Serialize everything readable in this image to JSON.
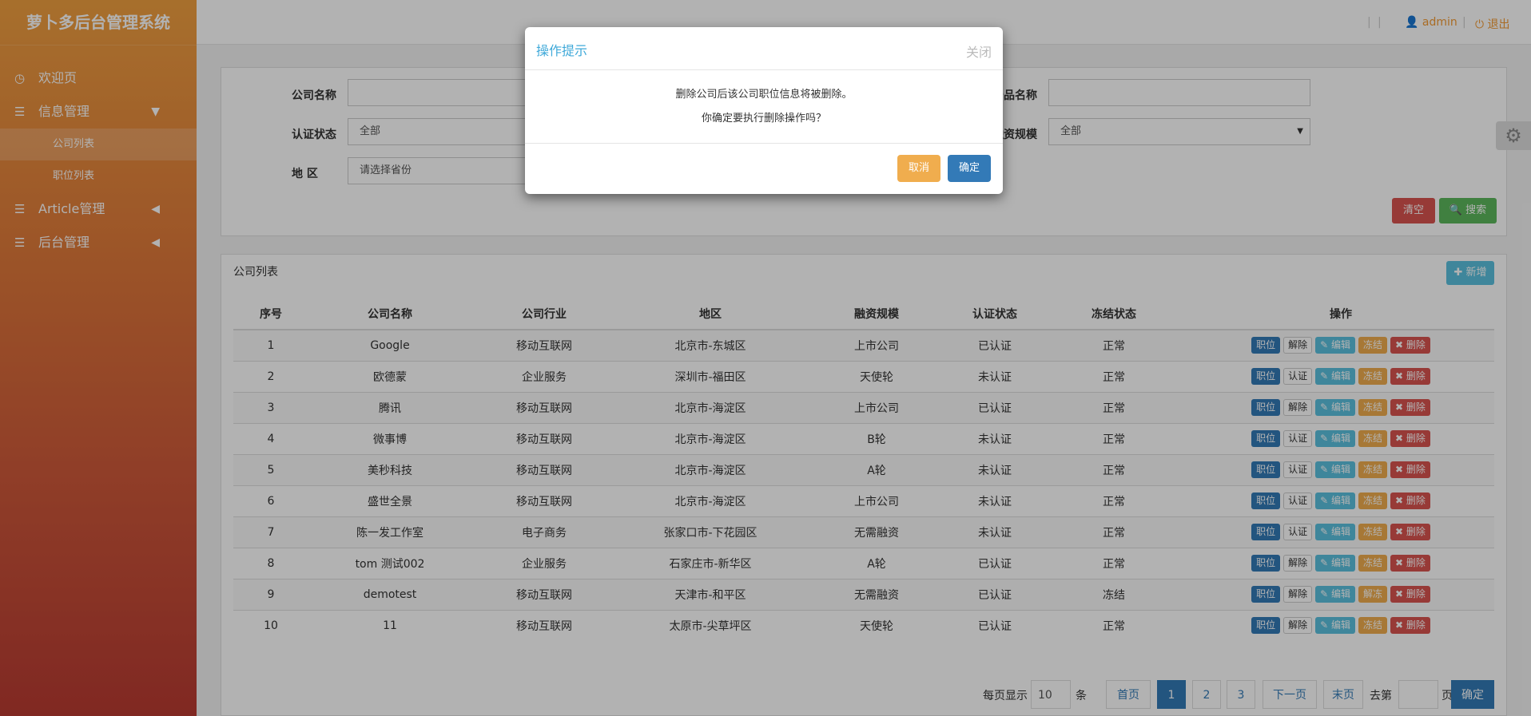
{
  "brand": "萝卜多后台管理系统",
  "sidebar": {
    "items": [
      {
        "label": "欢迎页",
        "icon": "dashboard-icon"
      },
      {
        "label": "信息管理",
        "icon": "list-icon"
      },
      {
        "label": "Article管理",
        "icon": "list-icon"
      },
      {
        "label": "后台管理",
        "icon": "list-icon"
      }
    ],
    "sub": [
      {
        "label": "公司列表"
      },
      {
        "label": "职位列表"
      }
    ]
  },
  "topbar": {
    "user": "admin",
    "logout": "退出"
  },
  "filters": {
    "company_label": "公司名称",
    "product_label": "产品名称",
    "auth_label": "认证状态",
    "auth_value": "全部",
    "finance_label": "融资规模",
    "finance_value": "全部",
    "region_label": "地 区",
    "region_placeholder": "请选择省份",
    "clear_label": "清空",
    "search_label": "搜索"
  },
  "list": {
    "title": "公司列表",
    "add_label": "新增",
    "columns": [
      "序号",
      "公司名称",
      "公司行业",
      "地区",
      "融资规模",
      "认证状态",
      "冻结状态",
      "操作"
    ],
    "op_labels": {
      "job": "职位",
      "edit": "编辑",
      "delete": "删除"
    },
    "rows": [
      {
        "no": "1",
        "name": "Google",
        "industry": "移动互联网",
        "region": "北京市-东城区",
        "finance": "上市公司",
        "auth": "已认证",
        "freeze": "正常",
        "rel": "解除",
        "frz": "冻结"
      },
      {
        "no": "2",
        "name": "欧德蒙",
        "industry": "企业服务",
        "region": "深圳市-福田区",
        "finance": "天使轮",
        "auth": "未认证",
        "freeze": "正常",
        "rel": "认证",
        "frz": "冻结"
      },
      {
        "no": "3",
        "name": "腾讯",
        "industry": "移动互联网",
        "region": "北京市-海淀区",
        "finance": "上市公司",
        "auth": "已认证",
        "freeze": "正常",
        "rel": "解除",
        "frz": "冻结"
      },
      {
        "no": "4",
        "name": "微事博",
        "industry": "移动互联网",
        "region": "北京市-海淀区",
        "finance": "B轮",
        "auth": "未认证",
        "freeze": "正常",
        "rel": "认证",
        "frz": "冻结"
      },
      {
        "no": "5",
        "name": "美秒科技",
        "industry": "移动互联网",
        "region": "北京市-海淀区",
        "finance": "A轮",
        "auth": "未认证",
        "freeze": "正常",
        "rel": "认证",
        "frz": "冻结"
      },
      {
        "no": "6",
        "name": "盛世全景",
        "industry": "移动互联网",
        "region": "北京市-海淀区",
        "finance": "上市公司",
        "auth": "未认证",
        "freeze": "正常",
        "rel": "认证",
        "frz": "冻结"
      },
      {
        "no": "7",
        "name": "陈一发工作室",
        "industry": "电子商务",
        "region": "张家口市-下花园区",
        "finance": "无需融资",
        "auth": "未认证",
        "freeze": "正常",
        "rel": "认证",
        "frz": "冻结"
      },
      {
        "no": "8",
        "name": "tom 测试002",
        "industry": "企业服务",
        "region": "石家庄市-新华区",
        "finance": "A轮",
        "auth": "已认证",
        "freeze": "正常",
        "rel": "解除",
        "frz": "冻结"
      },
      {
        "no": "9",
        "name": "demotest",
        "industry": "移动互联网",
        "region": "天津市-和平区",
        "finance": "无需融资",
        "auth": "已认证",
        "freeze": "冻结",
        "rel": "解除",
        "frz": "解冻"
      },
      {
        "no": "10",
        "name": "11",
        "industry": "移动互联网",
        "region": "太原市-尖草坪区",
        "finance": "天使轮",
        "auth": "已认证",
        "freeze": "正常",
        "rel": "解除",
        "frz": "冻结"
      }
    ]
  },
  "pager": {
    "per_page_label": "每页显示",
    "per_page_value": "10",
    "unit": "条",
    "first": "首页",
    "pages": [
      "1",
      "2",
      "3"
    ],
    "next": "下一页",
    "last": "末页",
    "goto_label": "去第",
    "page_unit": "页",
    "confirm": "确定"
  },
  "modal": {
    "title": "操作提示",
    "close": "关闭",
    "line1": "删除公司后该公司职位信息将被删除。",
    "line2": "你确定要执行删除操作吗？",
    "cancel": "取消",
    "ok": "确定"
  },
  "colors": {
    "primary": "#337ab7",
    "warning": "#f0ad4e",
    "danger": "#d9534f",
    "success": "#5cb85c",
    "info": "#5bc0de"
  }
}
